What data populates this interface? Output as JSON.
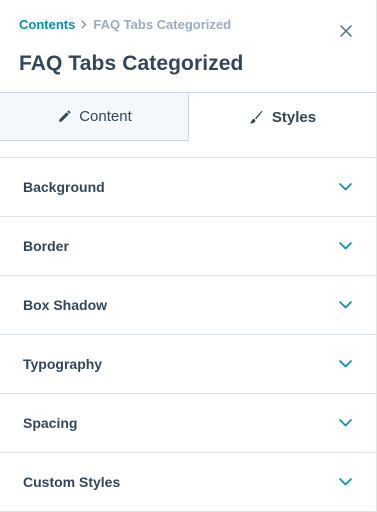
{
  "breadcrumb": {
    "parent": "Contents",
    "current": "FAQ Tabs Categorized"
  },
  "header": {
    "title": "FAQ Tabs Categorized"
  },
  "tabs": [
    {
      "label": "Content",
      "icon": "pencil-icon",
      "active": false
    },
    {
      "label": "Styles",
      "icon": "brush-icon",
      "active": true
    }
  ],
  "sections": [
    {
      "label": "Background",
      "icon": "chevron-down-icon"
    },
    {
      "label": "Border",
      "icon": "chevron-down-icon"
    },
    {
      "label": "Box Shadow",
      "icon": "chevron-down-icon"
    },
    {
      "label": "Typography",
      "icon": "chevron-down-icon"
    },
    {
      "label": "Spacing",
      "icon": "chevron-down-icon"
    },
    {
      "label": "Custom Styles",
      "icon": "chevron-down-icon"
    }
  ],
  "colors": {
    "link": "#0091ae",
    "text": "#33475b",
    "muted": "#99acc2",
    "accent_chevron": "#0091ae",
    "tab_inactive_bg": "#f5f8fa",
    "divider": "#dfe3eb"
  }
}
